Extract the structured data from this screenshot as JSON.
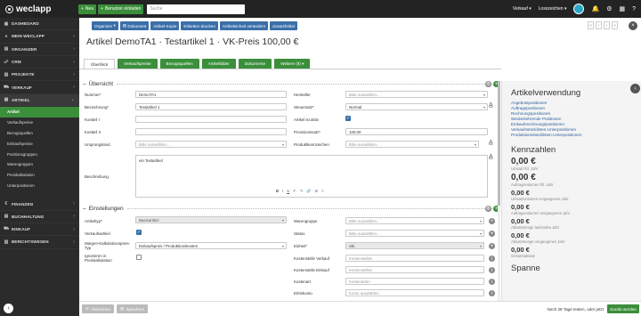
{
  "topbar": {
    "logo": "weclapp",
    "new_label": "Neu",
    "invite_label": "Benutzer einladen",
    "search_placeholder": "Suche",
    "sales_label": "Verkauf",
    "password_label": "Losszeichen"
  },
  "sidebar": {
    "items": [
      {
        "label": "DASHBOARD",
        "icon": "dashboard-icon"
      },
      {
        "label": "MEIN WECLAPP",
        "icon": "user-icon"
      },
      {
        "label": "ORGANIZER",
        "icon": "calendar-icon"
      },
      {
        "label": "CRM",
        "icon": "crm-icon"
      },
      {
        "label": "PROJEKTE",
        "icon": "projects-icon"
      },
      {
        "label": "VERKAUF",
        "icon": "cart-icon"
      },
      {
        "label": "ARTIKEL",
        "icon": "box-icon"
      }
    ],
    "subitems": [
      "Artikel",
      "Verkaufspreise",
      "Bezugsquellen",
      "Einkaufspreise",
      "Positionsgruppen",
      "Warengruppen",
      "Preiskalkulation",
      "Unterpositionen"
    ],
    "bottom_items": [
      {
        "label": "FINANZEN",
        "icon": "finance-icon"
      },
      {
        "label": "BUCHHALTUNG",
        "icon": "ledger-icon"
      },
      {
        "label": "EINKAUF",
        "icon": "purchase-icon"
      },
      {
        "label": "BERICHTSWESEN",
        "icon": "report-icon"
      }
    ]
  },
  "toolbar": {
    "organize": "Organizer",
    "document": "Dokument",
    "copy": "Artikel-Kopie",
    "labels": "Etiketten drucken",
    "unit": "Artikeleinheit verändern",
    "extra": "Zusatzfelder"
  },
  "page_title": "Artikel DemoTA1 · Testartikel 1 · VK-Preis 100,00 €",
  "tabs": [
    "Überblick",
    "Verkaufspreise",
    "Bezugsquellen",
    "Artikelbilder",
    "Dokumente",
    "Weitere (8)"
  ],
  "overview": {
    "section_title": "Übersicht",
    "nummer_label": "Nummer*",
    "nummer_value": "DemoTA1",
    "bezeichnung_label": "Bezeichnung*",
    "bezeichnung_value": "Testartikel 1",
    "kostenst1_label": "Kostteil I",
    "kostenst2_label": "Kostteil II",
    "ursprungsland_label": "Ursprungsland",
    "ursprungsland_placeholder": "Bitte auswählen...",
    "hersteller_label": "Hersteller",
    "hersteller_placeholder": "Bitte auswählen...",
    "steuersatz_label": "Steuersatz*",
    "steuersatz_value": "Normal",
    "aktiv_label": "Artikel ist aktiv",
    "provision_label": "Provisionssatz*",
    "provision_value": "100,00",
    "produktkennz_label": "Produktkennzeichen",
    "produktkennz_placeholder": "Bitte auswählen...",
    "beschreibung_label": "Beschreibung",
    "beschreibung_value": "ein Testartikel"
  },
  "settings": {
    "section_title": "Einstellungen",
    "artikeltyp_label": "Artikeltyp*",
    "artikeltyp_value": "Basisartikel",
    "verkaufsartikel_label": "Verkaufsartikel",
    "margen_label": "Margen-Kalkulationspreis-Typ",
    "margen_value": "Einkaufspreis / Produktionskosten",
    "ignorieren_label": "Ignorieren in Preiskalkulation",
    "warengruppe_label": "Warengruppe",
    "warengruppe_placeholder": "Bitte auswählen...",
    "status_label": "Status",
    "status_placeholder": "Bitte auswählen...",
    "einheit_label": "Einheit*",
    "einheit_value": "Stk.",
    "kst_verkauf_label": "Kostenstelle Verkauf",
    "kst_verkauf_placeholder": "Kostenstellen",
    "kst_einkauf_label": "Kostenstelle Einkauf",
    "kst_einkauf_placeholder": "Kostenstellen",
    "kostenart_label": "Kostenart",
    "kostenart_placeholder": "Kostenarten",
    "erloeskonto_label": "Erlöskonto",
    "erloeskonto_placeholder": "Konto auswählen"
  },
  "right_panel": {
    "usage_title": "Artikelverwendung",
    "usage_links": [
      "Angebotspositionen",
      "Auftragspositionen",
      "Rechnungspositionen",
      "Wiederkehrende Positionen",
      "Einkaufsrechnungspositionen",
      "Verkaufsstücklisten-Unterpositionen",
      "Produktionsstücklisten-Unterpositionen"
    ],
    "kpi_title": "Kennzahlen",
    "kpis": [
      {
        "value": "0,00 €",
        "label": "Umsatz lfd. Jahr"
      },
      {
        "value": "0,00 €",
        "label": "Auftragsvolumen lfd. Jahr"
      },
      {
        "value": "0,00 €",
        "label": "Umsatzvolumen vergangenes Jahr"
      },
      {
        "value": "0,00 €",
        "label": "Auftragsvolumen vergangenes Jahr"
      },
      {
        "value": "0,00 €",
        "label": "Absatzmenge laufendes Jahr"
      },
      {
        "value": "0,00 €",
        "label": "Absatzmenge vergangenes Jahr"
      },
      {
        "value": "0,00 €",
        "label": "Gesamtabsatz"
      }
    ],
    "spanne_title": "Spanne"
  },
  "bottombar": {
    "cancel": "Abbrechen",
    "save": "Speichern",
    "trial_text": "Noch 28 Tage testen, oder jetzt",
    "buy": "Kunde werden"
  },
  "colors": {
    "green": "#3a8e3a",
    "blue": "#3a6fa8",
    "dark": "#232323"
  }
}
